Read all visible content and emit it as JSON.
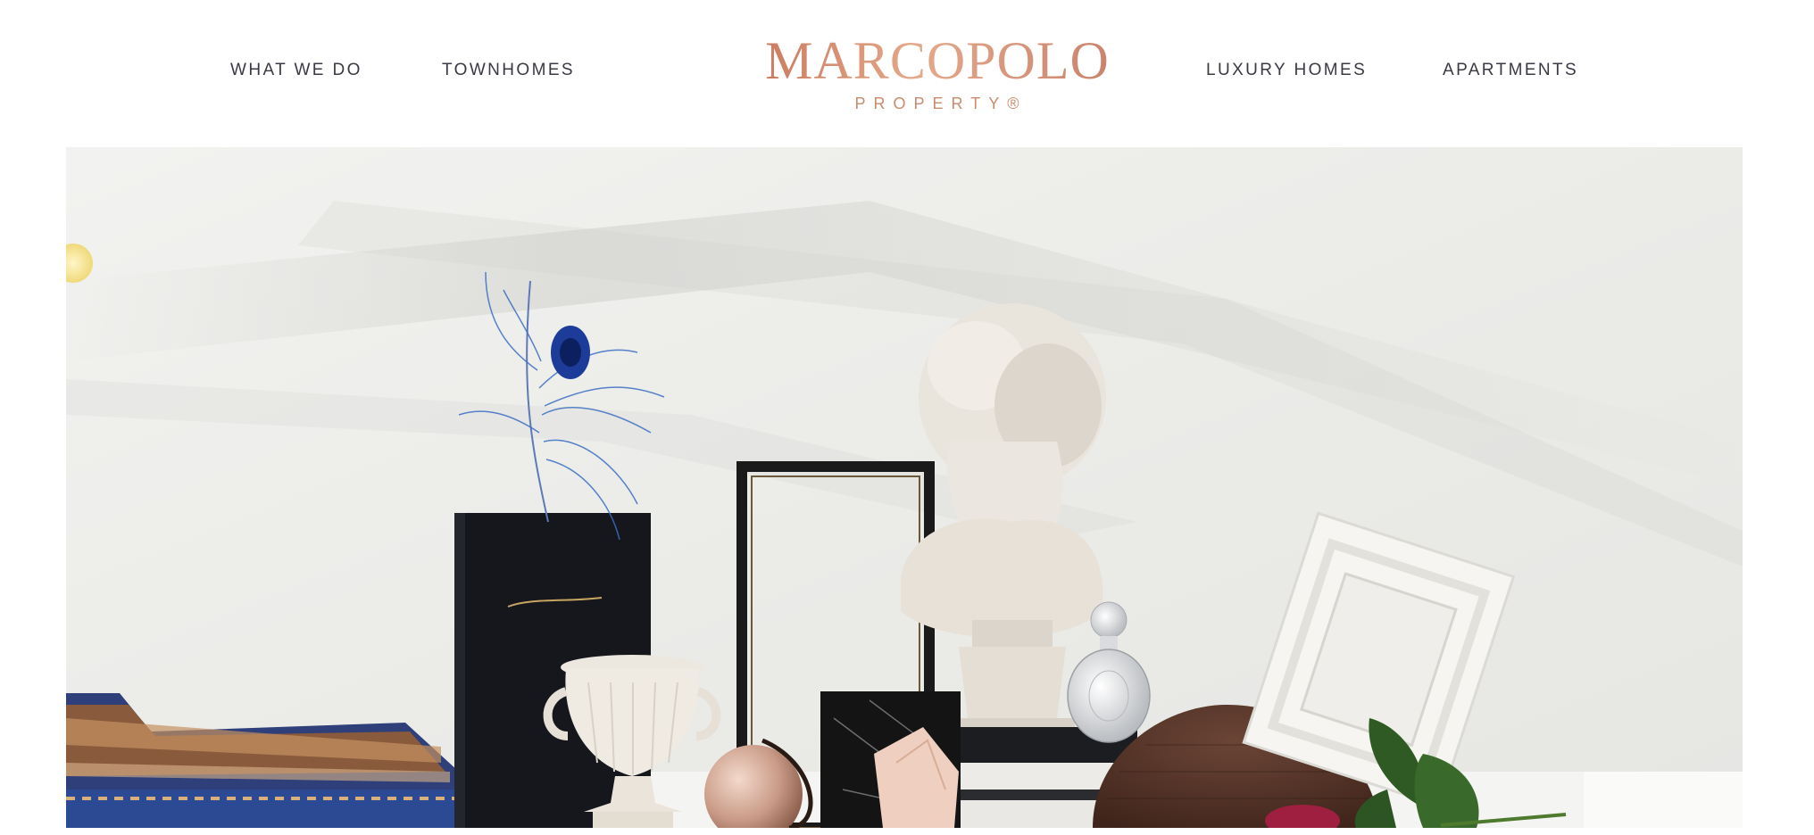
{
  "nav": {
    "left": [
      {
        "label": "WHAT WE DO"
      },
      {
        "label": "TOWNHOMES"
      }
    ],
    "right": [
      {
        "label": "LUXURY HOMES"
      },
      {
        "label": "APARTMENTS"
      }
    ]
  },
  "logo": {
    "main": "MARCOPOLO",
    "sub": "PROPERTY®"
  },
  "colors": {
    "brand": "#cf8a6a",
    "nav_text": "#3a3a44",
    "hero_wall": "#ededeb"
  }
}
